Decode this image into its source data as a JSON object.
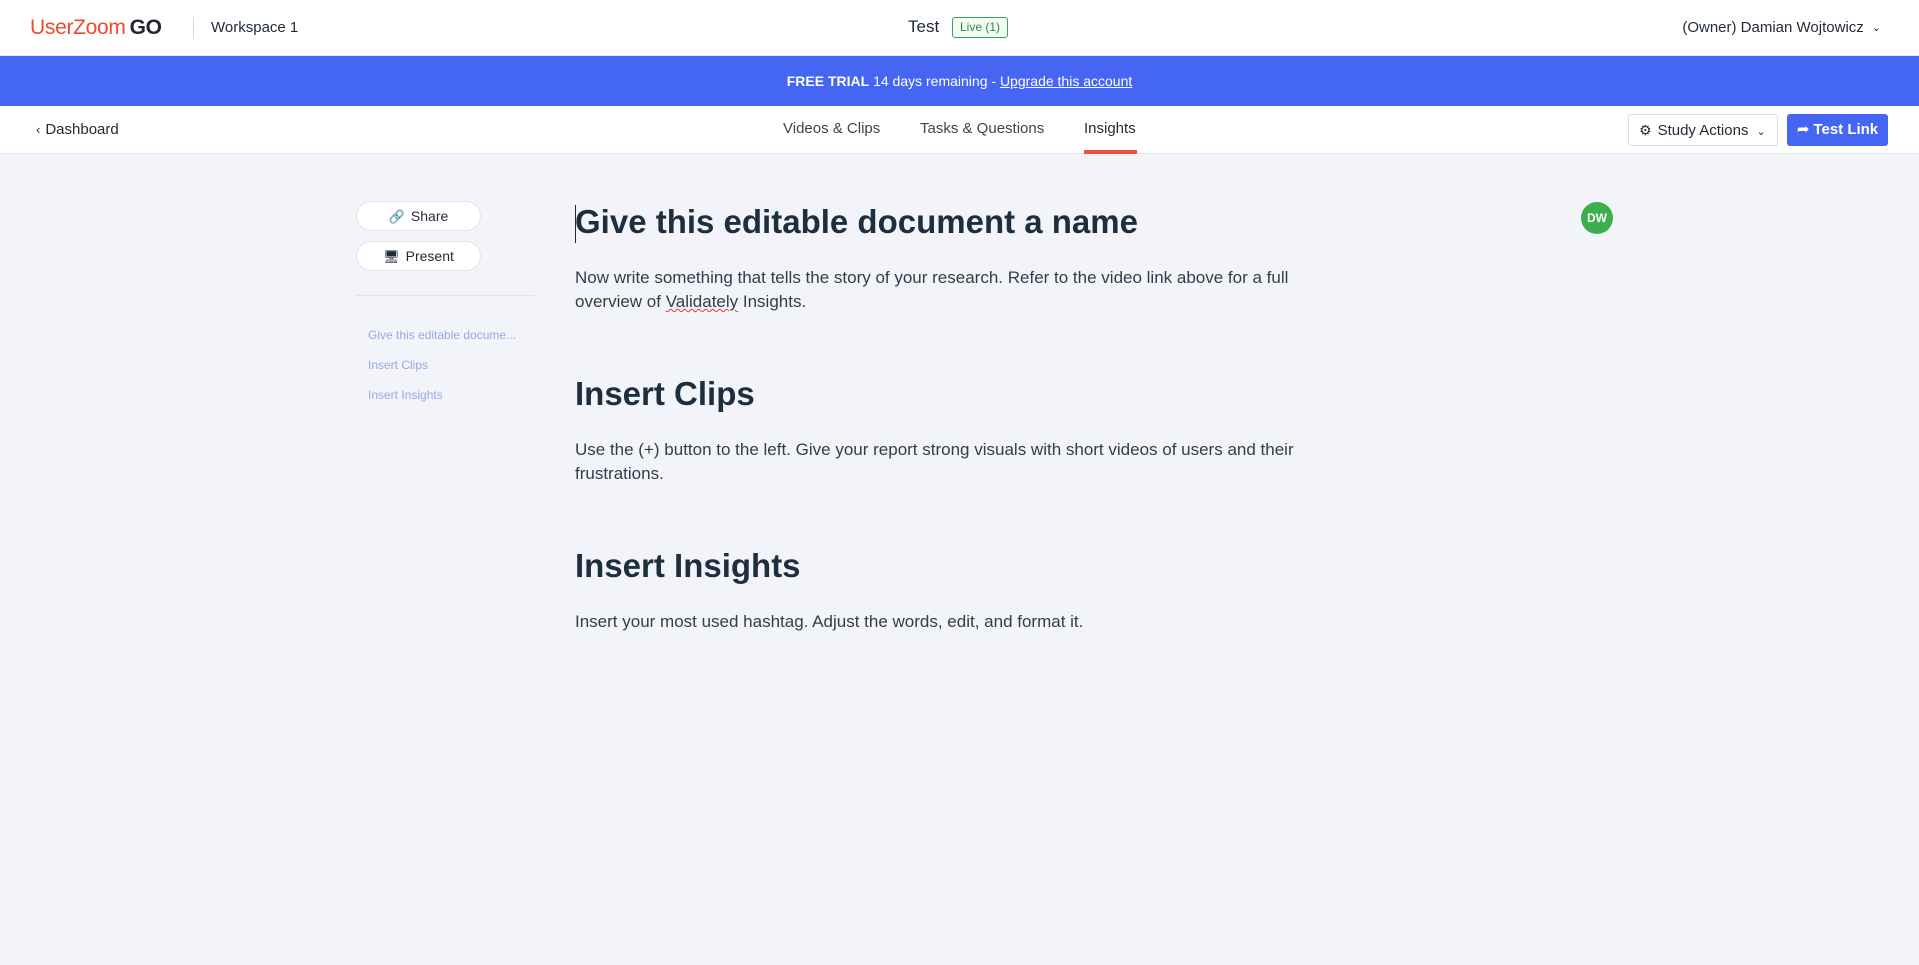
{
  "header": {
    "logo_primary": "UserZoom",
    "logo_secondary": "GO",
    "workspace": "Workspace 1",
    "test_title": "Test",
    "live_badge": "Live (1)",
    "owner": "(Owner) Damian Wojtowicz"
  },
  "banner": {
    "label": "FREE TRIAL",
    "text": " 14 days remaining - ",
    "link": "Upgrade this account",
    "color": "#4466f2"
  },
  "nav": {
    "back": "Dashboard",
    "tabs": [
      {
        "label": "Videos & Clips"
      },
      {
        "label": "Tasks & Questions"
      },
      {
        "label": "Insights",
        "active": true
      }
    ],
    "study_actions": "Study Actions",
    "test_link": "Test Link"
  },
  "sidebar": {
    "share": "Share",
    "present": "Present",
    "toc": [
      "Give this editable docume...",
      "Insert Clips",
      "Insert Insights"
    ]
  },
  "document": {
    "sections": [
      {
        "heading": "Give this editable document a name",
        "body_before": "Now write something that tells the story of your research. Refer to the video link above for a full overview of ",
        "body_flag": "Validately",
        "body_after": " Insights."
      },
      {
        "heading": "Insert Clips",
        "body": "Use the (+) button to the left. Give your report strong visuals with short videos of users and their frustrations."
      },
      {
        "heading": "Insert Insights",
        "body": "Insert your most used hashtag. Adjust the words, edit, and format it."
      }
    ]
  },
  "avatar": {
    "initials": "DW",
    "color": "#3dae4c"
  },
  "colors": {
    "accent": "#4466f2",
    "brand": "#ee4a2e",
    "tab_indicator": "#e8513c"
  }
}
